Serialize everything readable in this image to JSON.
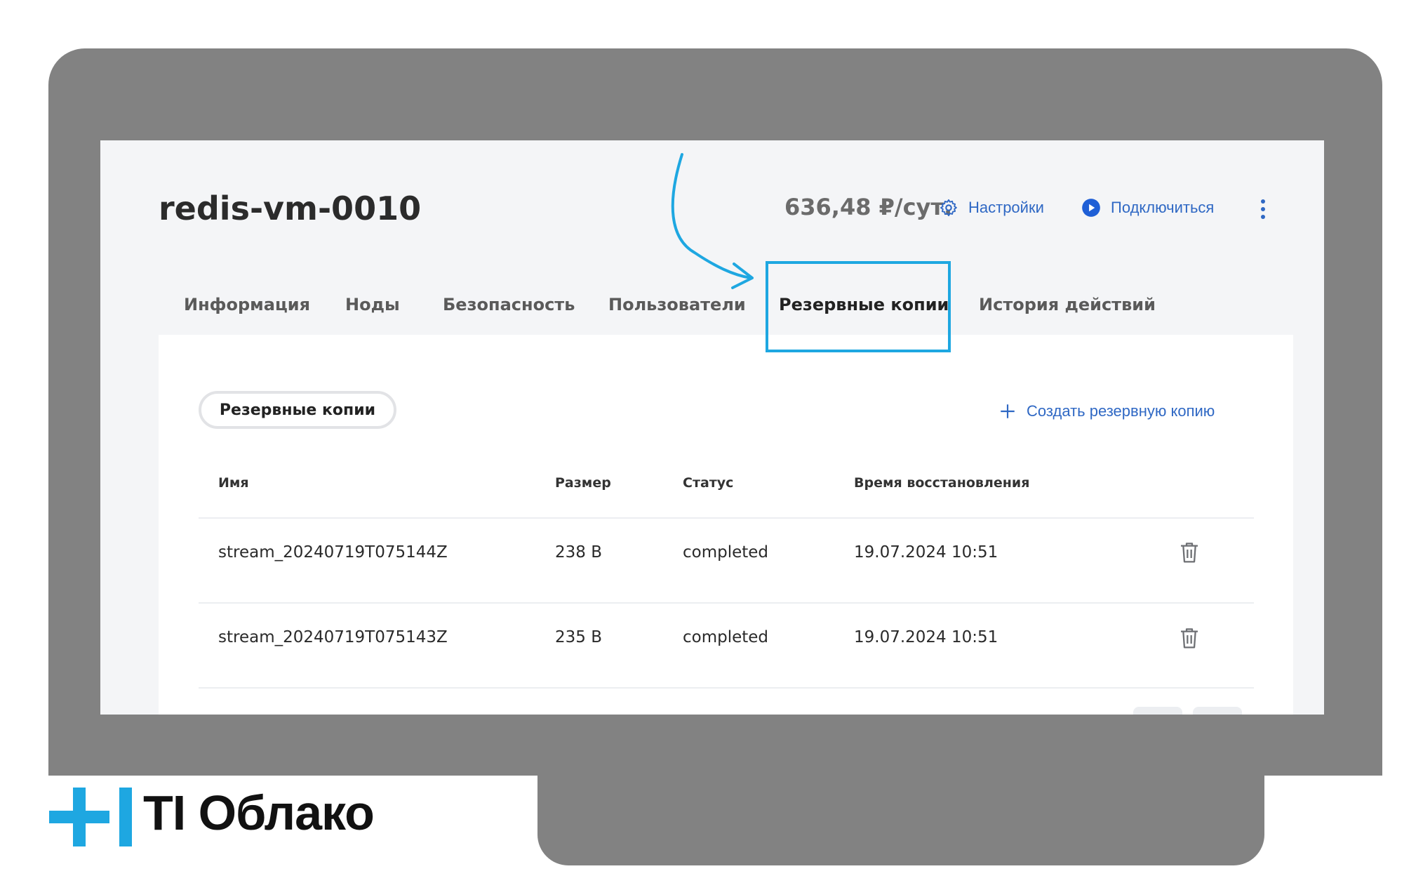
{
  "service": {
    "title": "redis-vm-0010",
    "price": "636,48 ₽/сут.",
    "settings_label": "Настройки",
    "connect_label": "Подключиться"
  },
  "tabs": [
    {
      "label": "Информация"
    },
    {
      "label": "Ноды"
    },
    {
      "label": "Безопасность"
    },
    {
      "label": "Пользователи"
    },
    {
      "label": "Резервные копии",
      "active": true
    },
    {
      "label": "История действий"
    }
  ],
  "backups": {
    "section_label": "Резервные копии",
    "create_label": "Создать резервную копию",
    "columns": [
      "Имя",
      "Размер",
      "Статус",
      "Время восстановления"
    ],
    "rows": [
      {
        "name": "stream_20240719T075144Z",
        "size": "238 B",
        "status": "completed",
        "restore_time": "19.07.2024 10:51"
      },
      {
        "name": "stream_20240719T075143Z",
        "size": "235 B",
        "status": "completed",
        "restore_time": "19.07.2024 10:51"
      }
    ]
  },
  "brand": {
    "name": "TI Облако",
    "accent_color": "#1ea7e1",
    "link_color": "#2f68c4",
    "frame_color": "#828282"
  },
  "icons": {
    "settings": "gear-icon",
    "connect": "play-circle-icon",
    "more": "kebab-menu-icon",
    "create": "plus-icon",
    "delete": "trash-icon",
    "annotation": "curved-arrow-icon"
  }
}
